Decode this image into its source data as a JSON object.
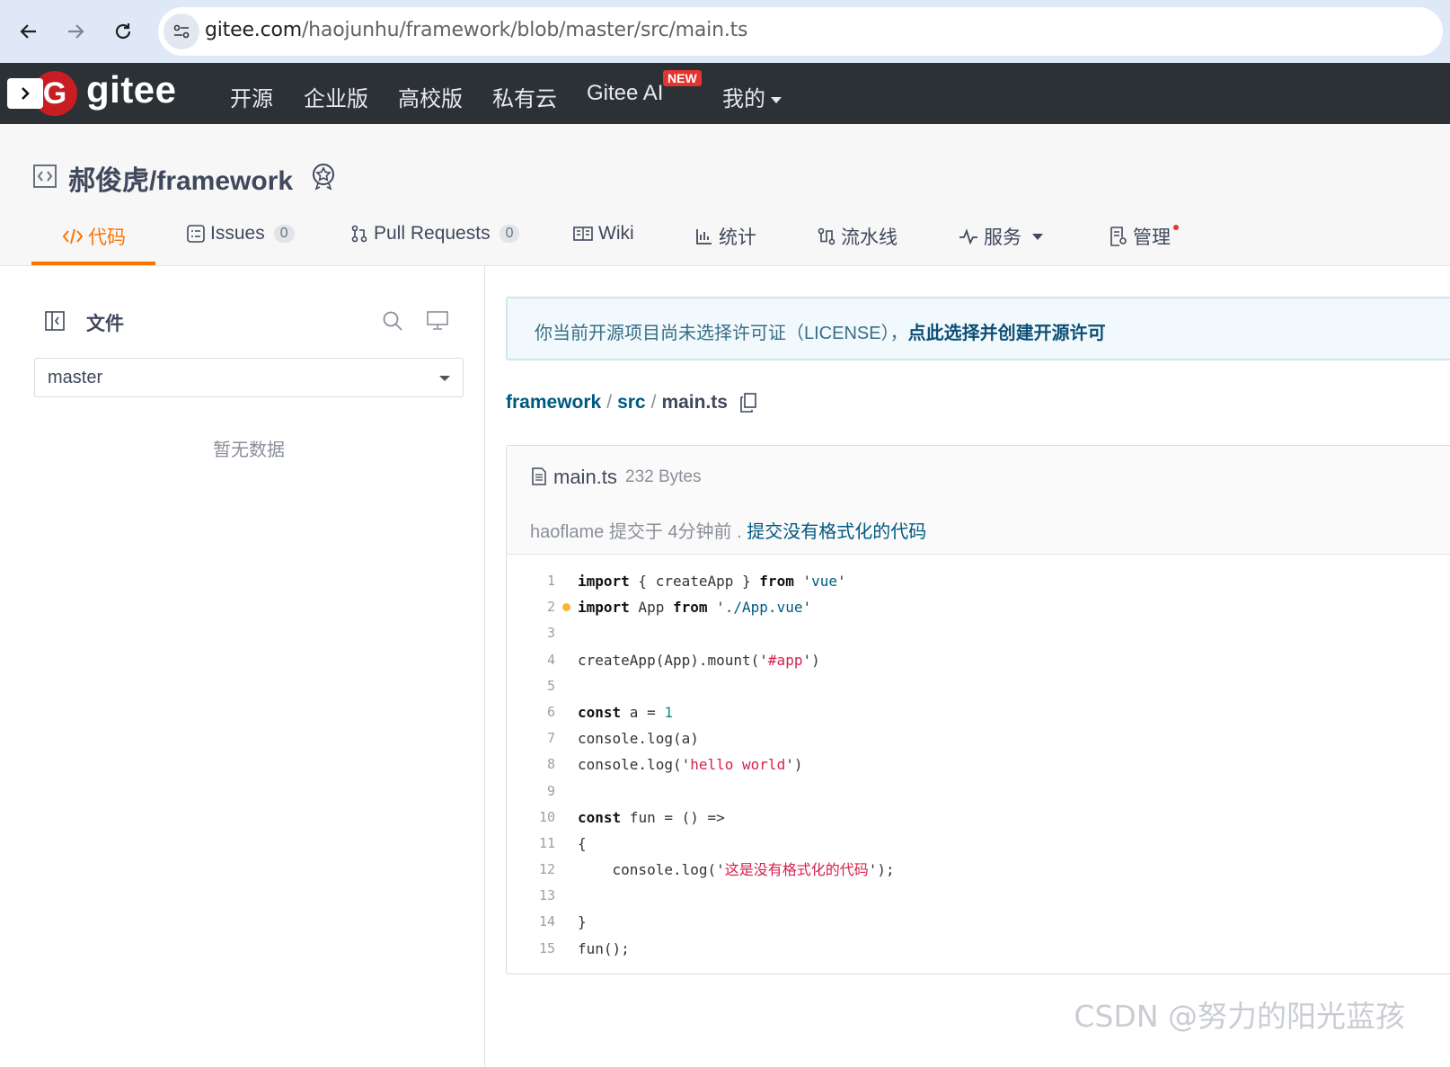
{
  "browser": {
    "url_host": "gitee.com",
    "url_path": "/haojunhu/framework/blob/master/src/main.ts"
  },
  "header": {
    "logo_text": "gitee",
    "logo_mark": "G",
    "nav": [
      "开源",
      "企业版",
      "高校版",
      "私有云",
      "Gitee AI",
      "我的"
    ],
    "new_badge": "NEW"
  },
  "repo": {
    "title": "郝俊虎/framework",
    "tabs": [
      {
        "label": "代码"
      },
      {
        "label": "Issues",
        "count": "0"
      },
      {
        "label": "Pull Requests",
        "count": "0"
      },
      {
        "label": "Wiki"
      },
      {
        "label": "统计"
      },
      {
        "label": "流水线"
      },
      {
        "label": "服务"
      },
      {
        "label": "管理"
      }
    ]
  },
  "sidebar": {
    "title": "文件",
    "branch": "master",
    "empty": "暂无数据"
  },
  "license": {
    "message": "你当前开源项目尚未选择许可证（LICENSE），",
    "link": "点此选择并创建开源许可"
  },
  "breadcrumb": [
    "framework",
    "src",
    "main.ts"
  ],
  "file": {
    "name": "main.ts",
    "size": "232 Bytes",
    "author": "haoflame",
    "commit_meta": "提交于 4分钟前 .",
    "commit_msg": "提交没有格式化的代码",
    "lines": [
      "import { createApp } from 'vue'",
      "import App from './App.vue'",
      "",
      "createApp(App).mount('#app')",
      "",
      "const a = 1",
      "console.log(a)",
      "console.log('hello world')",
      "",
      "const fun = () =>",
      "{",
      "    console.log('这是没有格式化的代码');",
      "",
      "}",
      "fun();"
    ]
  },
  "watermark": "CSDN @努力的阳光蓝孩",
  "colors": {
    "accent": "#fe7300",
    "header_bg": "#2c3136",
    "link": "#005980"
  }
}
